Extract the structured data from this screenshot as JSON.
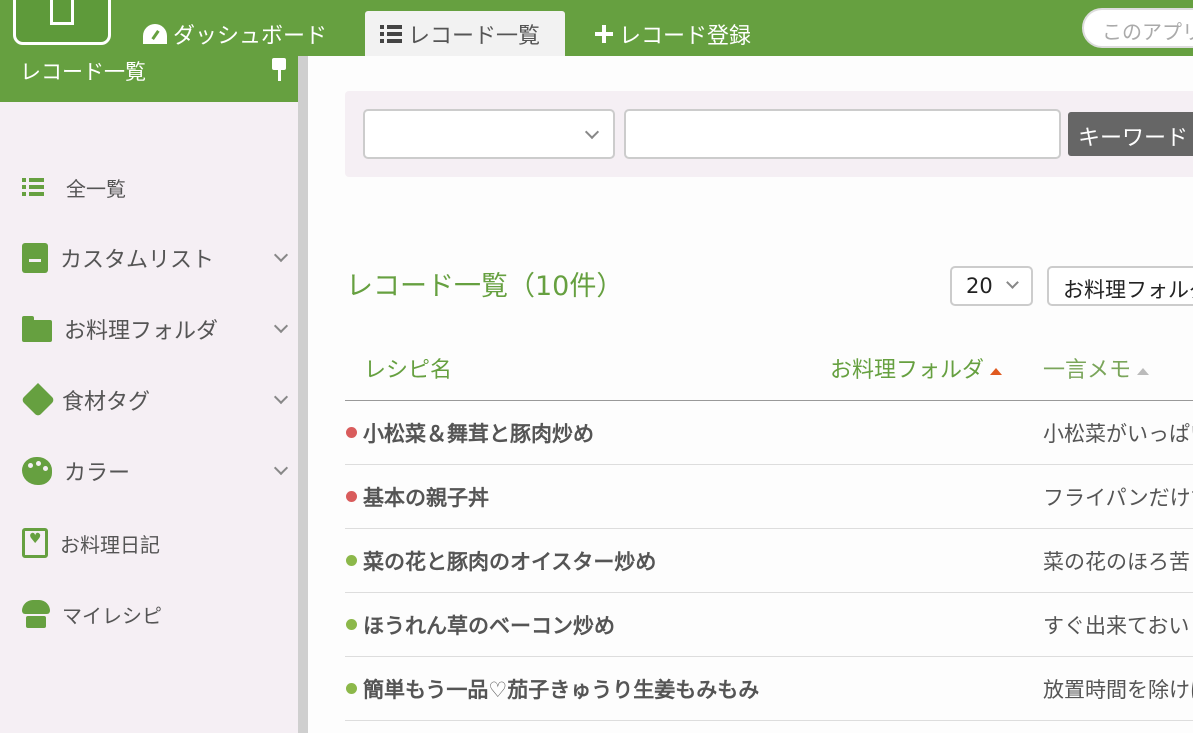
{
  "header": {
    "tabs": [
      {
        "label": "ダッシュボード",
        "icon": "gauge-icon"
      },
      {
        "label": "レコード一覧",
        "icon": "list-icon",
        "active": true
      },
      {
        "label": "レコード登録",
        "icon": "plus-icon"
      }
    ],
    "search_placeholder": "このアプリ"
  },
  "sidebar": {
    "title": "レコード一覧",
    "items": [
      {
        "label": "全一覧",
        "icon": "list-icon"
      },
      {
        "label": "カスタムリスト",
        "icon": "book-icon"
      },
      {
        "label": "お料理フォルダ",
        "icon": "folder-icon"
      },
      {
        "label": "食材タグ",
        "icon": "tag-icon"
      },
      {
        "label": "カラー",
        "icon": "palette-icon"
      },
      {
        "label": "お料理日記",
        "icon": "diary-icon"
      },
      {
        "label": "マイレシピ",
        "icon": "chef-hat-icon"
      }
    ]
  },
  "search": {
    "field_select_value": "",
    "keyword_value": "",
    "keyword_button": "キーワード"
  },
  "list": {
    "title": "レコード一覧（10件）",
    "per_page": "20",
    "folder_select": "お料理フォルダ",
    "columns": {
      "name": "レシピ名",
      "folder": "お料理フォルダ",
      "memo": "一言メモ"
    },
    "rows": [
      {
        "name": "小松菜＆舞茸と豚肉炒め",
        "memo": "小松菜がいっぱい",
        "color": "#d95c5c"
      },
      {
        "name": "基本の親子丼",
        "memo": "フライパンだけで",
        "color": "#d95c5c"
      },
      {
        "name": "菜の花と豚肉のオイスター炒め",
        "memo": "菜の花のほろ苦さ",
        "color": "#8cb84a"
      },
      {
        "name": "ほうれん草のベーコン炒め",
        "memo": "すぐ出来ておいし",
        "color": "#8cb84a"
      },
      {
        "name": "簡単もう一品♡茄子きゅうり生姜もみもみ",
        "memo": "放置時間を除けば",
        "color": "#8cb84a"
      }
    ]
  },
  "colors": {
    "brand": "#66a040",
    "sidebar_bg": "#f5eff4",
    "sort_active": "#e05a20"
  }
}
